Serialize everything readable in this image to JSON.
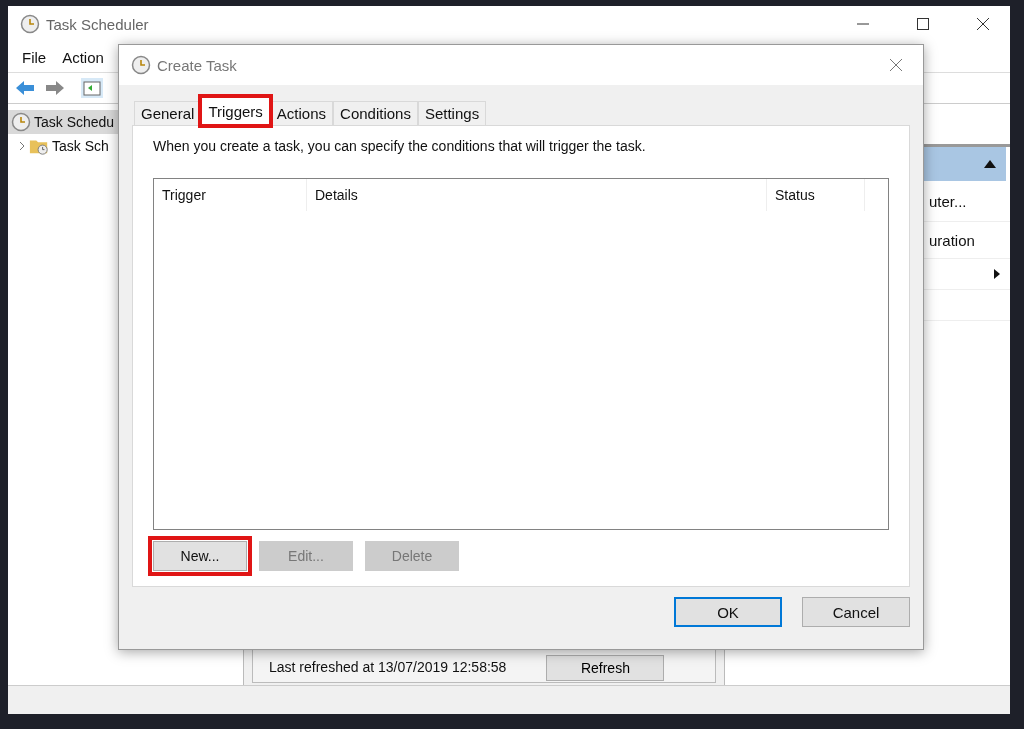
{
  "main_window": {
    "title": "Task Scheduler",
    "menu": [
      "File",
      "Action"
    ],
    "tree": [
      {
        "kind": "root",
        "label": "Task Schedu",
        "selected": true
      },
      {
        "kind": "folder",
        "label": "Task Sch",
        "selected": false
      }
    ],
    "center": {
      "status_text": "Last refreshed at 13/07/2019 12:58:58",
      "refresh_button": "Refresh"
    },
    "actions_pane": [
      {
        "kind": "header"
      },
      {
        "kind": "text",
        "label": "uter..."
      },
      {
        "kind": "text",
        "label": "uration"
      },
      {
        "kind": "submenu"
      },
      {
        "kind": "blank"
      }
    ]
  },
  "dialog": {
    "title": "Create Task",
    "tabs": [
      {
        "label": "General",
        "selected": false,
        "highlighted": false
      },
      {
        "label": "Triggers",
        "selected": true,
        "highlighted": true
      },
      {
        "label": "Actions",
        "selected": false,
        "highlighted": false
      },
      {
        "label": "Conditions",
        "selected": false,
        "highlighted": false
      },
      {
        "label": "Settings",
        "selected": false,
        "highlighted": false
      }
    ],
    "description": "When you create a task, you can specify the conditions that will trigger the task.",
    "table": {
      "columns": [
        "Trigger",
        "Details",
        "Status"
      ]
    },
    "buttons": [
      {
        "label": "New...",
        "disabled": false,
        "highlighted": true
      },
      {
        "label": "Edit...",
        "disabled": true,
        "highlighted": false
      },
      {
        "label": "Delete",
        "disabled": true,
        "highlighted": false
      }
    ],
    "footer_buttons": [
      {
        "label": "OK",
        "default": true
      },
      {
        "label": "Cancel",
        "default": false
      }
    ]
  }
}
